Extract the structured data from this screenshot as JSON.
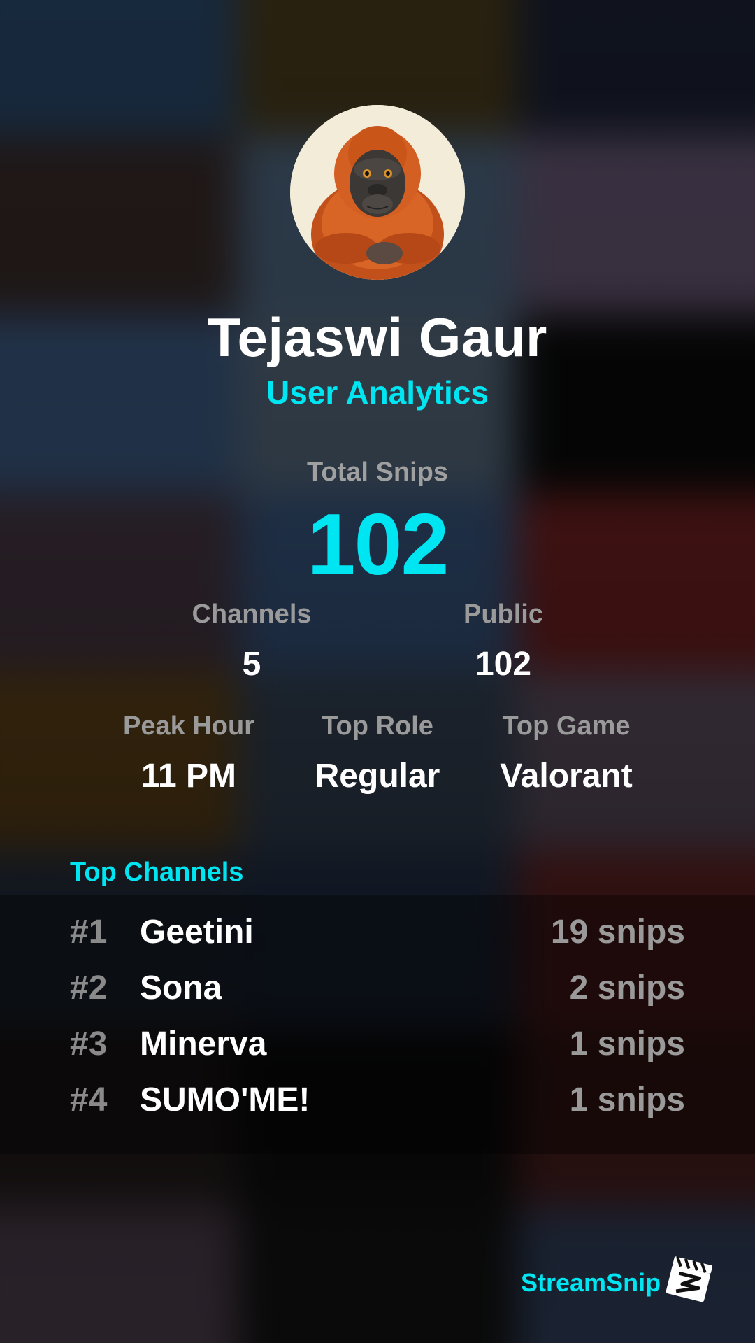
{
  "user": {
    "name": "Tejaswi Gaur",
    "subtitle": "User Analytics"
  },
  "totals": {
    "label": "Total Snips",
    "value": "102"
  },
  "stats_row1": [
    {
      "label": "Channels",
      "value": "5"
    },
    {
      "label": "Public",
      "value": "102"
    }
  ],
  "stats_row2": [
    {
      "label": "Peak Hour",
      "value": "11 PM"
    },
    {
      "label": "Top Role",
      "value": "Regular"
    },
    {
      "label": "Top Game",
      "value": "Valorant"
    }
  ],
  "top_channels": {
    "title": "Top Channels",
    "rows": [
      {
        "rank": "#1",
        "name": "Geetini",
        "count": "19 snips"
      },
      {
        "rank": "#2",
        "name": "Sona",
        "count": "2 snips"
      },
      {
        "rank": "#3",
        "name": "Minerva",
        "count": "1 snips"
      },
      {
        "rank": "#4",
        "name": "SUMO'ME!",
        "count": "1 snips"
      }
    ]
  },
  "brand": {
    "name": "StreamSnip",
    "logo_icon": "clapperboard-icon"
  },
  "avatar_icon": "orangutan-avatar",
  "colors": {
    "accent": "#00e5f2",
    "text": "#ffffff",
    "muted": "#9a9a9a"
  }
}
